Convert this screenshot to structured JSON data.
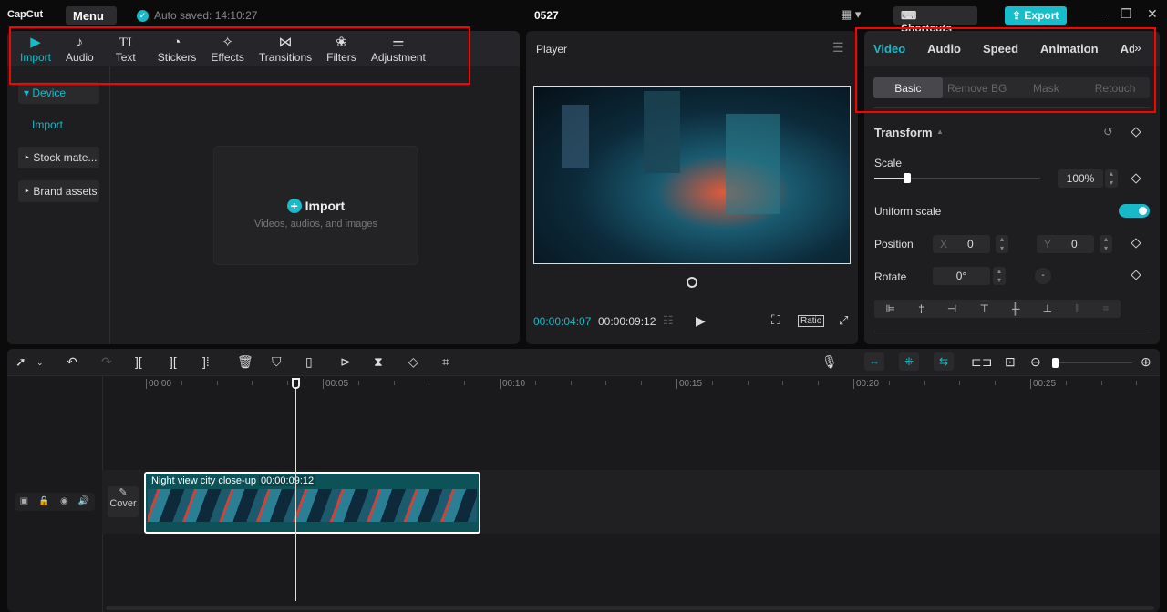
{
  "app": {
    "logo": "CapCut",
    "menu": "Menu",
    "auto_saved": "Auto saved: 14:10:27",
    "project_title": "0527",
    "shortcuts": "Shortcuts",
    "export": "Export"
  },
  "media_tabs": [
    {
      "label": "Import",
      "icon": "▶"
    },
    {
      "label": "Audio",
      "icon": "♪"
    },
    {
      "label": "Text",
      "icon": "TI"
    },
    {
      "label": "Stickers",
      "icon": "◔"
    },
    {
      "label": "Effects",
      "icon": "✧"
    },
    {
      "label": "Transitions",
      "icon": "⋈"
    },
    {
      "label": "Filters",
      "icon": "❀"
    },
    {
      "label": "Adjustment",
      "icon": "⚌"
    }
  ],
  "sidebar": {
    "device": "▾ Device",
    "import": "Import",
    "stock": "‣ Stock mate...",
    "brand": "‣ Brand assets"
  },
  "import_box": {
    "label": "Import",
    "hint": "Videos, audios, and images"
  },
  "player": {
    "title": "Player",
    "current_time": "00:00:04:07",
    "total_time": "00:00:09:12",
    "ratio": "Ratio"
  },
  "inspector": {
    "tabs": [
      "Video",
      "Audio",
      "Speed",
      "Animation",
      "Adju"
    ],
    "subtabs": [
      "Basic",
      "Remove BG",
      "Mask",
      "Retouch"
    ],
    "section": "Transform",
    "scale_label": "Scale",
    "scale_value": "100%",
    "scale_fraction": 0.2,
    "uniform_scale": "Uniform scale",
    "uniform_on": true,
    "position_label": "Position",
    "x_label": "X",
    "x_value": "0",
    "y_label": "Y",
    "y_value": "0",
    "rotate_label": "Rotate",
    "rotate_value": "0°"
  },
  "timeline": {
    "ruler": [
      "00:00",
      "00:05",
      "00:10",
      "00:15",
      "00:20",
      "00:25"
    ],
    "cover": "Cover",
    "clip_name": "Night view city close-up",
    "clip_duration": "00:00:09:12"
  },
  "colors": {
    "accent": "#18b9c8",
    "clip": "#0d5257"
  }
}
